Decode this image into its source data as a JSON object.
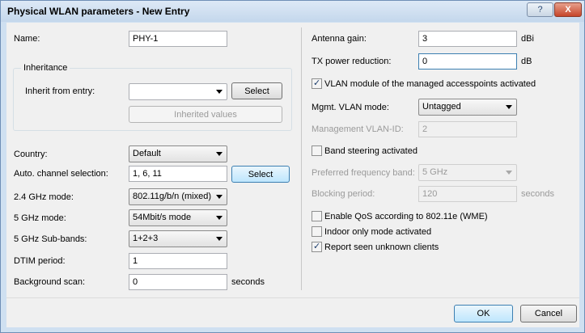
{
  "window": {
    "title": "Physical WLAN parameters - New Entry",
    "help_glyph": "?",
    "close_glyph": "X"
  },
  "left": {
    "name_label": "Name:",
    "name_value": "PHY-1",
    "inheritance_title": "Inheritance",
    "inherit_label": "Inherit from entry:",
    "inherit_value": "",
    "select_label": "Select",
    "inherited_values_label": "Inherited values",
    "country_label": "Country:",
    "country_value": "Default",
    "auto_channel_label": "Auto. channel selection:",
    "auto_channel_value": "1, 6, 11",
    "auto_channel_select": "Select",
    "mode24_label": "2.4 GHz mode:",
    "mode24_value": "802.11g/b/n (mixed)",
    "mode5_label": "5 GHz mode:",
    "mode5_value": "54Mbit/s mode",
    "subbands_label": "5 GHz Sub-bands:",
    "subbands_value": "1+2+3",
    "dtim_label": "DTIM period:",
    "dtim_value": "1",
    "bgscan_label": "Background scan:",
    "bgscan_value": "0",
    "bgscan_unit": "seconds"
  },
  "right": {
    "antenna_label": "Antenna gain:",
    "antenna_value": "3",
    "antenna_unit": "dBi",
    "tx_label": "TX power reduction:",
    "tx_value": "0",
    "tx_unit": "dB",
    "vlan_module_label": "VLAN module of the managed accesspoints activated",
    "vlan_module_checked": true,
    "mgmt_vlan_mode_label": "Mgmt. VLAN mode:",
    "mgmt_vlan_mode_value": "Untagged",
    "mgmt_vlan_id_label": "Management VLAN-ID:",
    "mgmt_vlan_id_value": "2",
    "band_steering_label": "Band steering activated",
    "band_steering_checked": false,
    "pref_band_label": "Preferred frequency band:",
    "pref_band_value": "5 GHz",
    "blocking_label": "Blocking period:",
    "blocking_value": "120",
    "blocking_unit": "seconds",
    "qos_label": "Enable QoS according to 802.11e (WME)",
    "qos_checked": false,
    "indoor_label": "Indoor only mode activated",
    "indoor_checked": false,
    "report_label": "Report seen unknown clients",
    "report_checked": true
  },
  "footer": {
    "ok_label": "OK",
    "cancel_label": "Cancel"
  },
  "check_glyph": "✓"
}
